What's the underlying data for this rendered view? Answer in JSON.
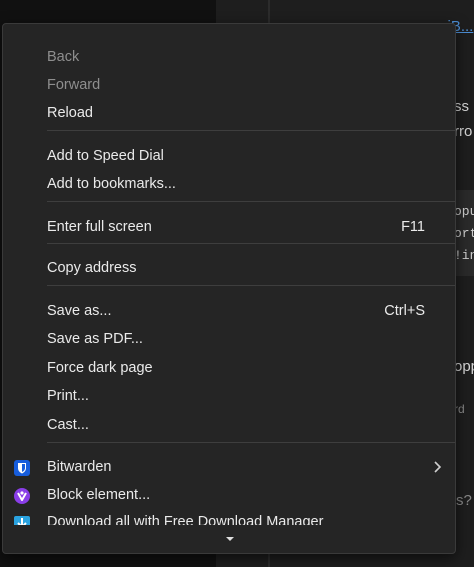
{
  "background": {
    "fragments": [
      "...rjB...",
      "ss",
      "rro",
      "opu",
      "ort",
      "!in",
      "opp",
      "rd",
      "s?"
    ]
  },
  "menu": {
    "back": "Back",
    "forward": "Forward",
    "reload": "Reload",
    "add_speed_dial": "Add to Speed Dial",
    "add_bookmarks": "Add to bookmarks...",
    "full_screen": "Enter full screen",
    "full_screen_shortcut": "F11",
    "copy_address": "Copy address",
    "save_as": "Save as...",
    "save_as_shortcut": "Ctrl+S",
    "save_pdf": "Save as PDF...",
    "force_dark": "Force dark page",
    "print": "Print...",
    "cast": "Cast...",
    "extensions": {
      "bitwarden": "Bitwarden",
      "block_element": "Block element...",
      "download_all": "Download all with Free Download Manager"
    }
  },
  "colors": {
    "menu_bg": "#252525",
    "text": "#eaeaea",
    "disabled_text": "#8e8e8e",
    "bitwarden": "#175DDC",
    "block_element": "#8a3ee8",
    "fdm": "#2aa3e0"
  },
  "icons": {
    "bitwarden": "bitwarden-shield-icon",
    "block_element": "block-element-icon",
    "download_all": "free-download-manager-icon",
    "submenu": "chevron-right-icon",
    "scroll": "chevron-down-icon"
  }
}
